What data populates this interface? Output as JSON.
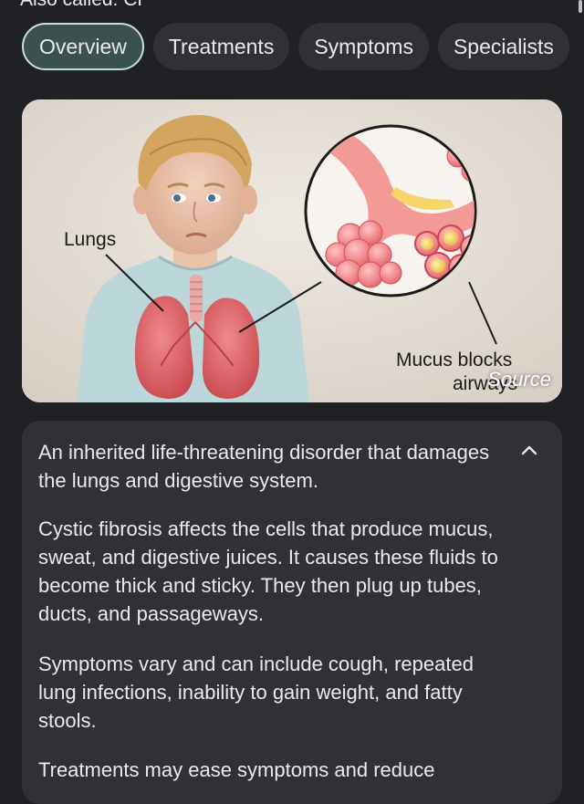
{
  "header": {
    "partial_text": "Also called: CF"
  },
  "tabs": [
    {
      "label": "Overview",
      "active": true
    },
    {
      "label": "Treatments",
      "active": false
    },
    {
      "label": "Symptoms",
      "active": false
    },
    {
      "label": "Specialists",
      "active": false
    }
  ],
  "illustration": {
    "label_lungs": "Lungs",
    "label_mucus_1": "Mucus blocks",
    "label_mucus_2": "airways",
    "source_label": "Source"
  },
  "overview": {
    "summary": "An inherited life-threatening disorder that damages the lungs and digestive system.",
    "paragraphs": [
      "Cystic fibrosis affects the cells that produce mucus, sweat, and digestive juices. It causes these fluids to become thick and sticky. They then plug up tubes, ducts, and passageways.",
      "Symptoms vary and can include cough, repeated lung infections, inability to gain weight, and fatty stools.",
      "Treatments may ease symptoms and reduce"
    ],
    "collapse_icon": "chevron-up-icon"
  },
  "colors": {
    "background": "#202124",
    "chip": "#303134",
    "chip_active": "#3b5150",
    "card": "#303134",
    "text": "#e8eaed"
  }
}
